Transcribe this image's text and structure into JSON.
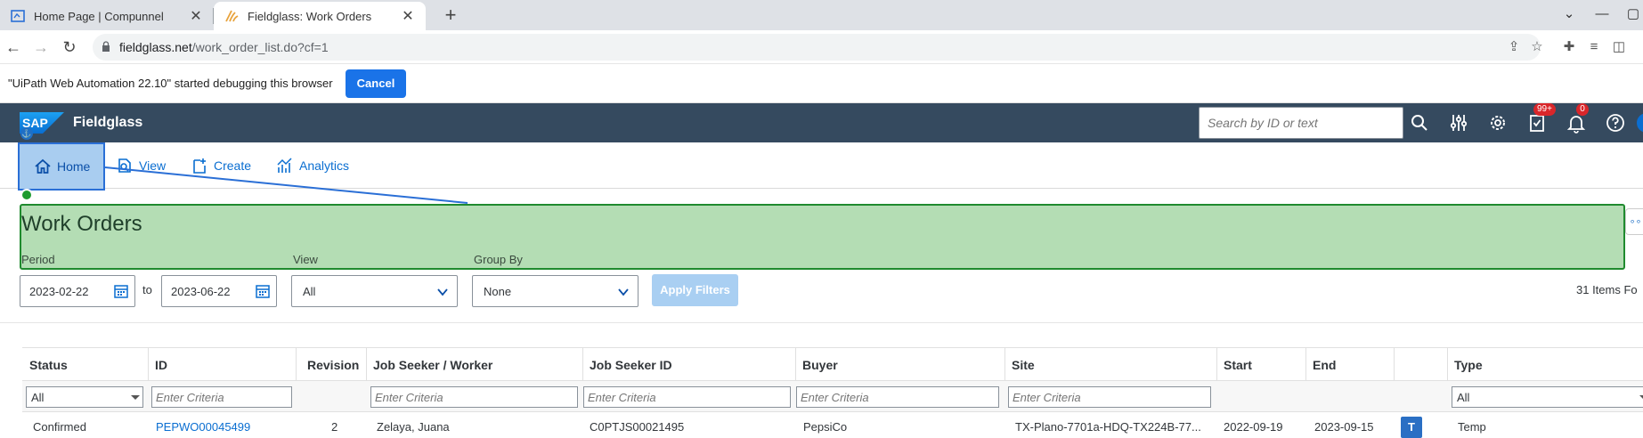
{
  "browser": {
    "tabs": [
      {
        "title": "Home Page | Compunnel",
        "active": false
      },
      {
        "title": "Fieldglass: Work Orders",
        "active": true
      }
    ],
    "url_host": "fieldglass.net",
    "url_path": "/work_order_list.do?cf=1"
  },
  "debug_bar": {
    "message": "\"UiPath Web Automation 22.10\" started debugging this browser",
    "cancel_label": "Cancel"
  },
  "shell": {
    "logo_text": "SAP",
    "app_name": "Fieldglass",
    "search_placeholder": "Search by ID or text",
    "tasks_badge": "99+",
    "notifications_badge": "0",
    "brand_color": "#354a5f"
  },
  "nav": {
    "items": [
      {
        "label": "Home",
        "icon": "home-icon",
        "selected": true
      },
      {
        "label": "View",
        "icon": "view-icon"
      },
      {
        "label": "Create",
        "icon": "create-icon"
      },
      {
        "label": "Analytics",
        "icon": "analytics-icon"
      }
    ]
  },
  "page": {
    "title": "Work Orders",
    "filters": {
      "period_label": "Period",
      "period_from": "2023-02-22",
      "to_label": "to",
      "period_to": "2023-06-22",
      "view_label": "View",
      "view_value": "All",
      "group_by_label": "Group By",
      "group_by_value": "None",
      "apply_label": "Apply Filters"
    },
    "item_count": "31 Items Fo"
  },
  "table": {
    "headers": [
      "Status",
      "ID",
      "Revision",
      "Job Seeker / Worker",
      "Job Seeker ID",
      "Buyer",
      "Site",
      "Start",
      "End",
      "",
      "Type"
    ],
    "filters": {
      "status": "All",
      "criteria_placeholder": "Enter Criteria",
      "type": "All"
    },
    "rows": [
      {
        "status": "Confirmed",
        "id": "PEPWO00045499",
        "revision": "2",
        "worker": "Zelaya, Juana",
        "job_seeker_id": "C0PTJS00021495",
        "buyer": "PepsiCo",
        "site": "TX-Plano-7701a-HDQ-TX224B-77...",
        "start": "2022-09-19",
        "end": "2023-09-15",
        "badge": "T",
        "type": "Temp"
      }
    ]
  }
}
